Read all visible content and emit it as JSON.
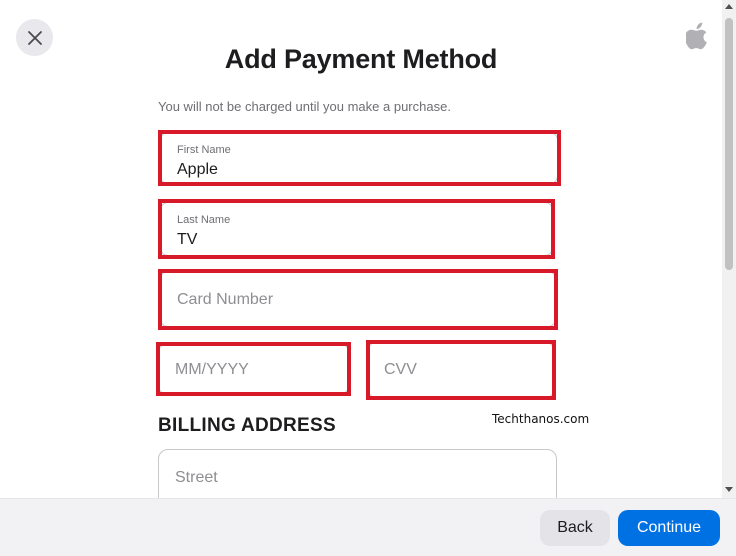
{
  "header": {
    "title": "Add Payment Method",
    "subtitle": "You will not be charged until you make a purchase."
  },
  "form": {
    "first_name": {
      "label": "First Name",
      "value": "Apple"
    },
    "last_name": {
      "label": "Last Name",
      "value": "TV"
    },
    "card_number": {
      "placeholder": "Card Number"
    },
    "expiry": {
      "placeholder": "MM/YYYY"
    },
    "cvv": {
      "placeholder": "CVV"
    },
    "billing_heading": "BILLING ADDRESS",
    "street": {
      "placeholder": "Street"
    }
  },
  "watermark": "Techthanos.com",
  "footer": {
    "back_label": "Back",
    "continue_label": "Continue"
  },
  "icons": {
    "close": "close-icon",
    "logo": "apple-logo-icon"
  },
  "colors": {
    "accent": "#0071e3",
    "highlight": "#d7192a"
  }
}
